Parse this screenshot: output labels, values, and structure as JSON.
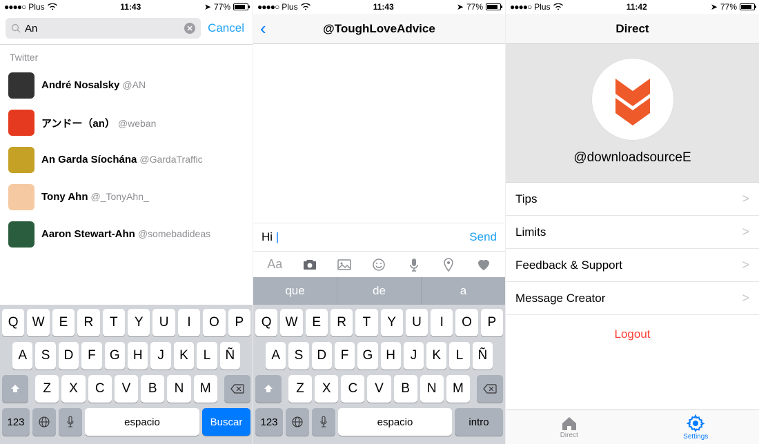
{
  "status": {
    "carrier": "Plus",
    "battery_pct": "77%",
    "dots": "●●●●○",
    "loc_glyph": "➤"
  },
  "pane1": {
    "time": "11:43",
    "search_value": "An",
    "cancel_label": "Cancel",
    "section": "Twitter",
    "results": [
      {
        "name": "André Nosalsky",
        "handle": "@AN"
      },
      {
        "name": "アンドー（an）",
        "handle": "@weban"
      },
      {
        "name": "An Garda Síochána",
        "handle": "@GardaTraffic"
      },
      {
        "name": "Tony Ahn",
        "handle": "@_TonyAhn_"
      },
      {
        "name": "Aaron Stewart-Ahn",
        "handle": "@somebadideas"
      }
    ]
  },
  "pane2": {
    "time": "11:43",
    "title": "@ToughLoveAdvice",
    "compose_value": "Hi",
    "send_label": "Send",
    "text_tool_label": "Aa",
    "suggestions": [
      "que",
      "de",
      "a"
    ]
  },
  "pane3": {
    "time": "11:42",
    "title": "Direct",
    "profile_handle": "@downloadsourceE",
    "cells": [
      "Tips",
      "Limits",
      "Feedback & Support",
      "Message Creator"
    ],
    "logout_label": "Logout",
    "tabs": {
      "direct": "Direct",
      "settings": "Settings"
    }
  },
  "keyboard": {
    "row1": [
      "Q",
      "W",
      "E",
      "R",
      "T",
      "Y",
      "U",
      "I",
      "O",
      "P"
    ],
    "row2": [
      "A",
      "S",
      "D",
      "F",
      "G",
      "H",
      "J",
      "K",
      "L",
      "Ñ"
    ],
    "row3": [
      "Z",
      "X",
      "C",
      "V",
      "B",
      "N",
      "M"
    ],
    "num_label": "123",
    "space_label": "espacio",
    "search_label": "Buscar",
    "intro_label": "intro"
  }
}
